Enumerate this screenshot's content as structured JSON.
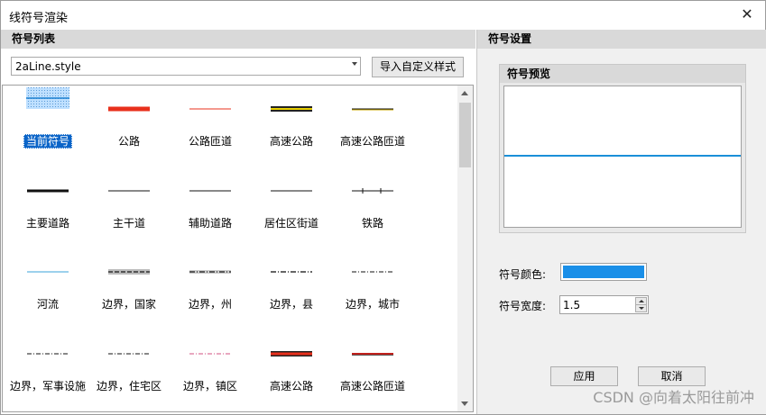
{
  "window": {
    "title": "线符号渲染"
  },
  "left": {
    "header": "符号列表",
    "style_file": "2aLine.style",
    "import_button": "导入自定义样式"
  },
  "right": {
    "header": "符号设置",
    "preview_title": "符号预览",
    "color_label": "符号颜色:",
    "color_value": "#1a8fe8",
    "width_label": "符号宽度:",
    "width_value": "1.5",
    "apply_button": "应用",
    "cancel_button": "取消"
  },
  "symbols": [
    {
      "label": "当前符号",
      "type": "current",
      "selected": true
    },
    {
      "label": "公路",
      "type": "thick",
      "color": "#e8301c"
    },
    {
      "label": "公路匝道",
      "type": "thin",
      "color": "#e8301c"
    },
    {
      "label": "高速公路",
      "type": "highway"
    },
    {
      "label": "高速公路匝道",
      "type": "ramp"
    },
    {
      "label": "主要道路",
      "type": "thick2",
      "color": "#111111"
    },
    {
      "label": "主干道",
      "type": "thin",
      "color": "#111111"
    },
    {
      "label": "辅助道路",
      "type": "thin",
      "color": "#111111"
    },
    {
      "label": "居住区街道",
      "type": "thin",
      "color": "#111111"
    },
    {
      "label": "铁路",
      "type": "rail"
    },
    {
      "label": "河流",
      "type": "thin",
      "color": "#3aa3d8"
    },
    {
      "label": "边界，国家",
      "type": "border1"
    },
    {
      "label": "边界，州",
      "type": "border2"
    },
    {
      "label": "边界，县",
      "type": "border3"
    },
    {
      "label": "边界，城市",
      "type": "dashdot",
      "color": "#111111"
    },
    {
      "label": "边界，军事设施",
      "type": "dashdot",
      "color": "#111111"
    },
    {
      "label": "边界，住宅区",
      "type": "dashdot",
      "color": "#111111"
    },
    {
      "label": "边界，镇区",
      "type": "dashdot",
      "color": "#d05080"
    },
    {
      "label": "高速公路",
      "type": "redhw"
    },
    {
      "label": "高速公路匝道",
      "type": "redramp"
    }
  ],
  "watermark": "CSDN @向着太阳往前冲"
}
